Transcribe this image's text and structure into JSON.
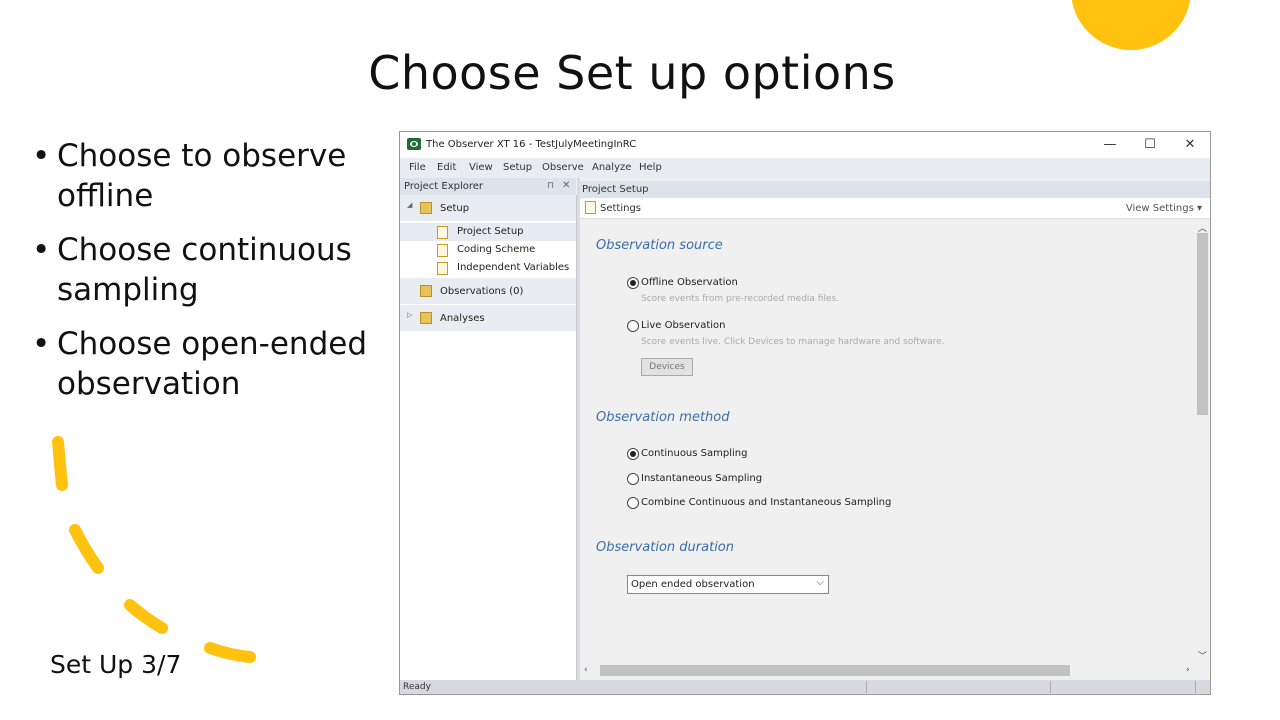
{
  "slide": {
    "title": "Choose Set up options",
    "bullets": [
      {
        "line1": "Choose to observe",
        "line2": "offline"
      },
      {
        "line1": "Choose continuous",
        "line2": "sampling"
      },
      {
        "line1": "Choose open-ended",
        "line2": "observation"
      }
    ],
    "footer": "Set Up 3/7",
    "accent_color": "#ffc20e"
  },
  "window": {
    "title": "The Observer XT 16 - TestJulyMeetingInRC",
    "controls": {
      "minimize": "—",
      "maximize": "☐",
      "close": "✕"
    },
    "menu": [
      "File",
      "Edit",
      "View",
      "Setup",
      "Observe",
      "Analyze",
      "Help"
    ],
    "explorer": {
      "header": "Project Explorer",
      "pin": "⊓",
      "close": "✕",
      "setup": "Setup",
      "setup_children": [
        "Project Setup",
        "Coding Scheme",
        "Independent Variables"
      ],
      "observations": "Observations (0)",
      "analyses": "Analyses"
    },
    "main": {
      "header": "Project Setup",
      "settings_label": "Settings",
      "view_settings": "View Settings",
      "observation_source": {
        "title": "Observation source",
        "offline_label": "Offline Observation",
        "offline_desc": "Score events from pre-recorded media files.",
        "live_label": "Live Observation",
        "live_desc": "Score events live. Click Devices to manage hardware and software.",
        "devices_button": "Devices",
        "selected": "Offline Observation"
      },
      "observation_method": {
        "title": "Observation method",
        "options": [
          "Continuous Sampling",
          "Instantaneous Sampling",
          "Combine Continuous and Instantaneous Sampling"
        ],
        "selected": "Continuous Sampling"
      },
      "observation_duration": {
        "title": "Observation duration",
        "value": "Open ended observation"
      }
    },
    "status": "Ready"
  }
}
